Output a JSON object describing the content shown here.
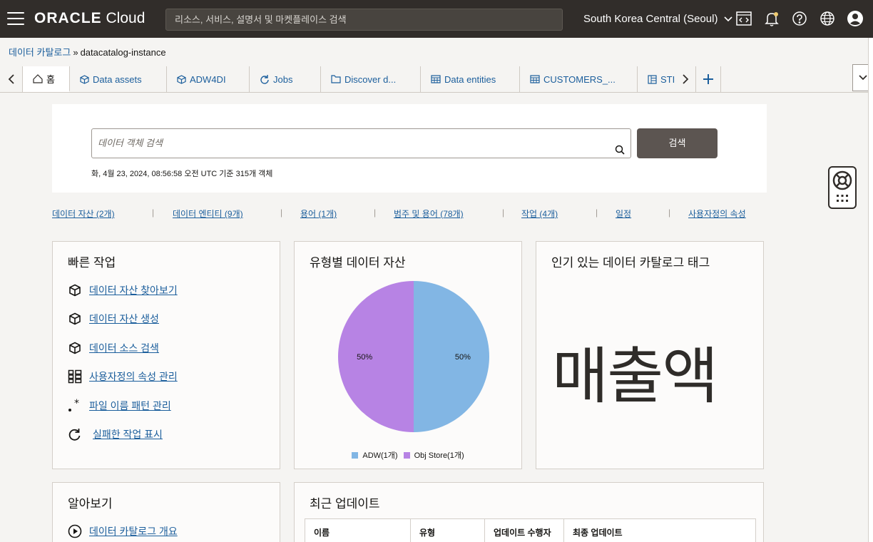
{
  "header": {
    "brand": "ORACLE",
    "product": "Cloud",
    "search_placeholder": "리소스, 서비스, 설명서 및 마켓플레이스 검색",
    "region": "South Korea Central (Seoul)"
  },
  "breadcrumb": {
    "parent": "데이터 카탈로그",
    "separator": "»",
    "current": "datacatalog-instance"
  },
  "tabs": [
    {
      "label": "홈",
      "icon": "home-icon"
    },
    {
      "label": "Data assets",
      "icon": "cube-icon"
    },
    {
      "label": "ADW4DI",
      "icon": "cube-icon"
    },
    {
      "label": "Jobs",
      "icon": "refresh-icon"
    },
    {
      "label": "Discover d...",
      "icon": "folder-icon"
    },
    {
      "label": "Data entities",
      "icon": "table-icon"
    },
    {
      "label": "CUSTOMERS_...",
      "icon": "table-icon"
    },
    {
      "label": "STI",
      "icon": "grid-icon"
    }
  ],
  "search": {
    "placeholder": "데이터 객체 검색",
    "button": "검색",
    "meta": "화, 4월 23, 2024, 08:56:58 오전 UTC 기준 315개 객체"
  },
  "quicklinks": [
    "데이터 자산 (2개)",
    "데이터 엔티티 (9개)",
    "용어 (1개)",
    "범주 및 용어 (78개)",
    "작업 (4개)",
    "일정",
    "사용자정의 속성"
  ],
  "quick_actions": {
    "title": "빠른 작업",
    "items": [
      {
        "label": "데이터 자산 찾아보기",
        "icon": "cube-icon"
      },
      {
        "label": "데이터 자산 생성",
        "icon": "cube-icon"
      },
      {
        "label": "데이터 소스 검색",
        "icon": "cube-icon"
      },
      {
        "label": "사용자정의 속성 관리",
        "icon": "grid-icon"
      },
      {
        "label": "파일 이름 패턴 관리",
        "icon": "pattern-icon"
      },
      {
        "label": "실패한 작업 표시",
        "icon": "refresh-icon"
      }
    ]
  },
  "assets_by_type": {
    "title": "유형별 데이터 자산"
  },
  "chart_data": {
    "type": "pie",
    "title": "유형별 데이터 자산",
    "categories": [
      "ADW(1개)",
      "Obj Store(1개)"
    ],
    "values": [
      1,
      1
    ],
    "percent_labels": [
      "50%",
      "50%"
    ],
    "colors": [
      "#82b6e4",
      "#b783e4"
    ],
    "legend": "bottom"
  },
  "popular_tags": {
    "title": "인기 있는 데이터 카탈로그 태그",
    "tags": [
      "매출액"
    ]
  },
  "learn": {
    "title": "알아보기",
    "items": [
      {
        "label": "데이터 카탈로그 개요",
        "icon": "play-icon"
      }
    ]
  },
  "recent_updates": {
    "title": "최근 업데이트",
    "columns": [
      "이름",
      "유형",
      "업데이트 수행자",
      "최종 업데이트"
    ]
  }
}
